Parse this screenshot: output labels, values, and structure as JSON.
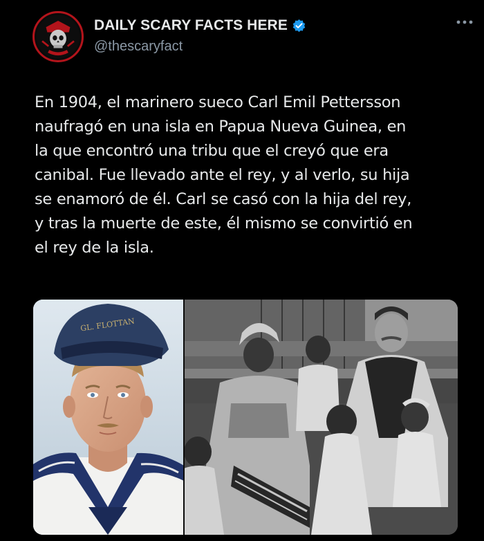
{
  "account": {
    "display_name": "DAILY SCARY FACTS HERE",
    "handle": "@thescaryfact",
    "verified": true,
    "avatar_icon": "skull-logo-icon",
    "avatar_logo_text": "WE SCARE FACT"
  },
  "menu": {
    "icon": "more-options-icon"
  },
  "tweet": {
    "text": "En 1904, el marinero sueco Carl Emil Pettersson\nnaufragó en una isla en Papua Nueva Guinea, en\nla que encontró una tribu que el creyó que era\ncanibal. Fue llevado ante el rey, y al verlo, su hija\nse enamoró de él. Carl se casó con la hija del rey,\ny tras la muerte de este, él mismo se convirtió en\nel rey de la isla."
  },
  "media": {
    "sailor_cap_text": "GL. FLOTTAN",
    "colors": {
      "cap": "#2c3f63",
      "collar": "#22346a",
      "skin": "#d9a78a",
      "photo_background": "#cfdbe6"
    }
  },
  "colors": {
    "background": "#000000",
    "text": "#e7e9ea",
    "secondary_text": "#8b98a5",
    "verified_blue": "#1d9bf0",
    "avatar_accent": "#b3141b"
  }
}
